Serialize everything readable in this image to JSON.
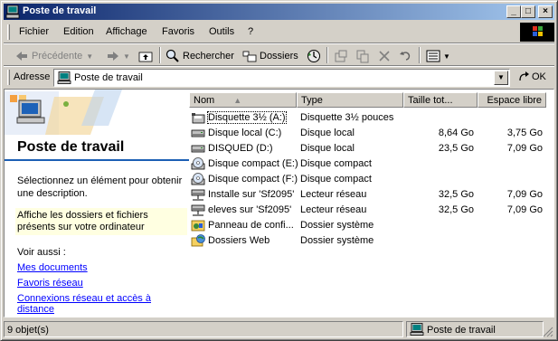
{
  "window": {
    "title": "Poste de travail"
  },
  "titlebar_buttons": {
    "minimize": "_",
    "maximize": "□",
    "close": "×"
  },
  "menu": [
    "Fichier",
    "Edition",
    "Affichage",
    "Favoris",
    "Outils",
    "?"
  ],
  "toolbar": {
    "back": "Précédente",
    "search": "Rechercher",
    "folders": "Dossiers"
  },
  "address": {
    "label": "Adresse",
    "value": "Poste de travail",
    "go": "OK"
  },
  "left_pane": {
    "title": "Poste de travail",
    "description": "Sélectionnez un élément pour obtenir une description.",
    "hint": "Affiche les dossiers et fichiers présents sur votre ordinateur",
    "see_also": "Voir aussi :",
    "links": [
      "Mes documents",
      "Favoris réseau",
      "Connexions réseau et accès à distance"
    ]
  },
  "list": {
    "columns": [
      "Nom",
      "Type",
      "Taille tot...",
      "Espace libre"
    ],
    "rows": [
      {
        "name": "Disquette 3½ (A:)",
        "type": "Disquette 3½ pouces",
        "total": "",
        "free": "",
        "icon": "floppy-icon"
      },
      {
        "name": "Disque local (C:)",
        "type": "Disque local",
        "total": "8,64 Go",
        "free": "3,75 Go",
        "icon": "hard-drive-icon"
      },
      {
        "name": "DISQUED (D:)",
        "type": "Disque local",
        "total": "23,5 Go",
        "free": "7,09 Go",
        "icon": "hard-drive-icon"
      },
      {
        "name": "Disque compact (E:)",
        "type": "Disque compact",
        "total": "",
        "free": "",
        "icon": "cd-drive-icon"
      },
      {
        "name": "Disque compact (F:)",
        "type": "Disque compact",
        "total": "",
        "free": "",
        "icon": "cd-drive-icon"
      },
      {
        "name": "Installe sur 'Sf2095'",
        "type": "Lecteur réseau",
        "total": "32,5 Go",
        "free": "7,09 Go",
        "icon": "network-drive-icon"
      },
      {
        "name": "eleves sur 'Sf2095'",
        "type": "Lecteur réseau",
        "total": "32,5 Go",
        "free": "7,09 Go",
        "icon": "network-drive-icon"
      },
      {
        "name": "Panneau de confi...",
        "type": "Dossier système",
        "total": "",
        "free": "",
        "icon": "control-panel-icon"
      },
      {
        "name": "Dossiers Web",
        "type": "Dossier système",
        "total": "",
        "free": "",
        "icon": "web-folders-icon"
      }
    ]
  },
  "status": {
    "count": "9 objet(s)",
    "location": "Poste de travail"
  }
}
